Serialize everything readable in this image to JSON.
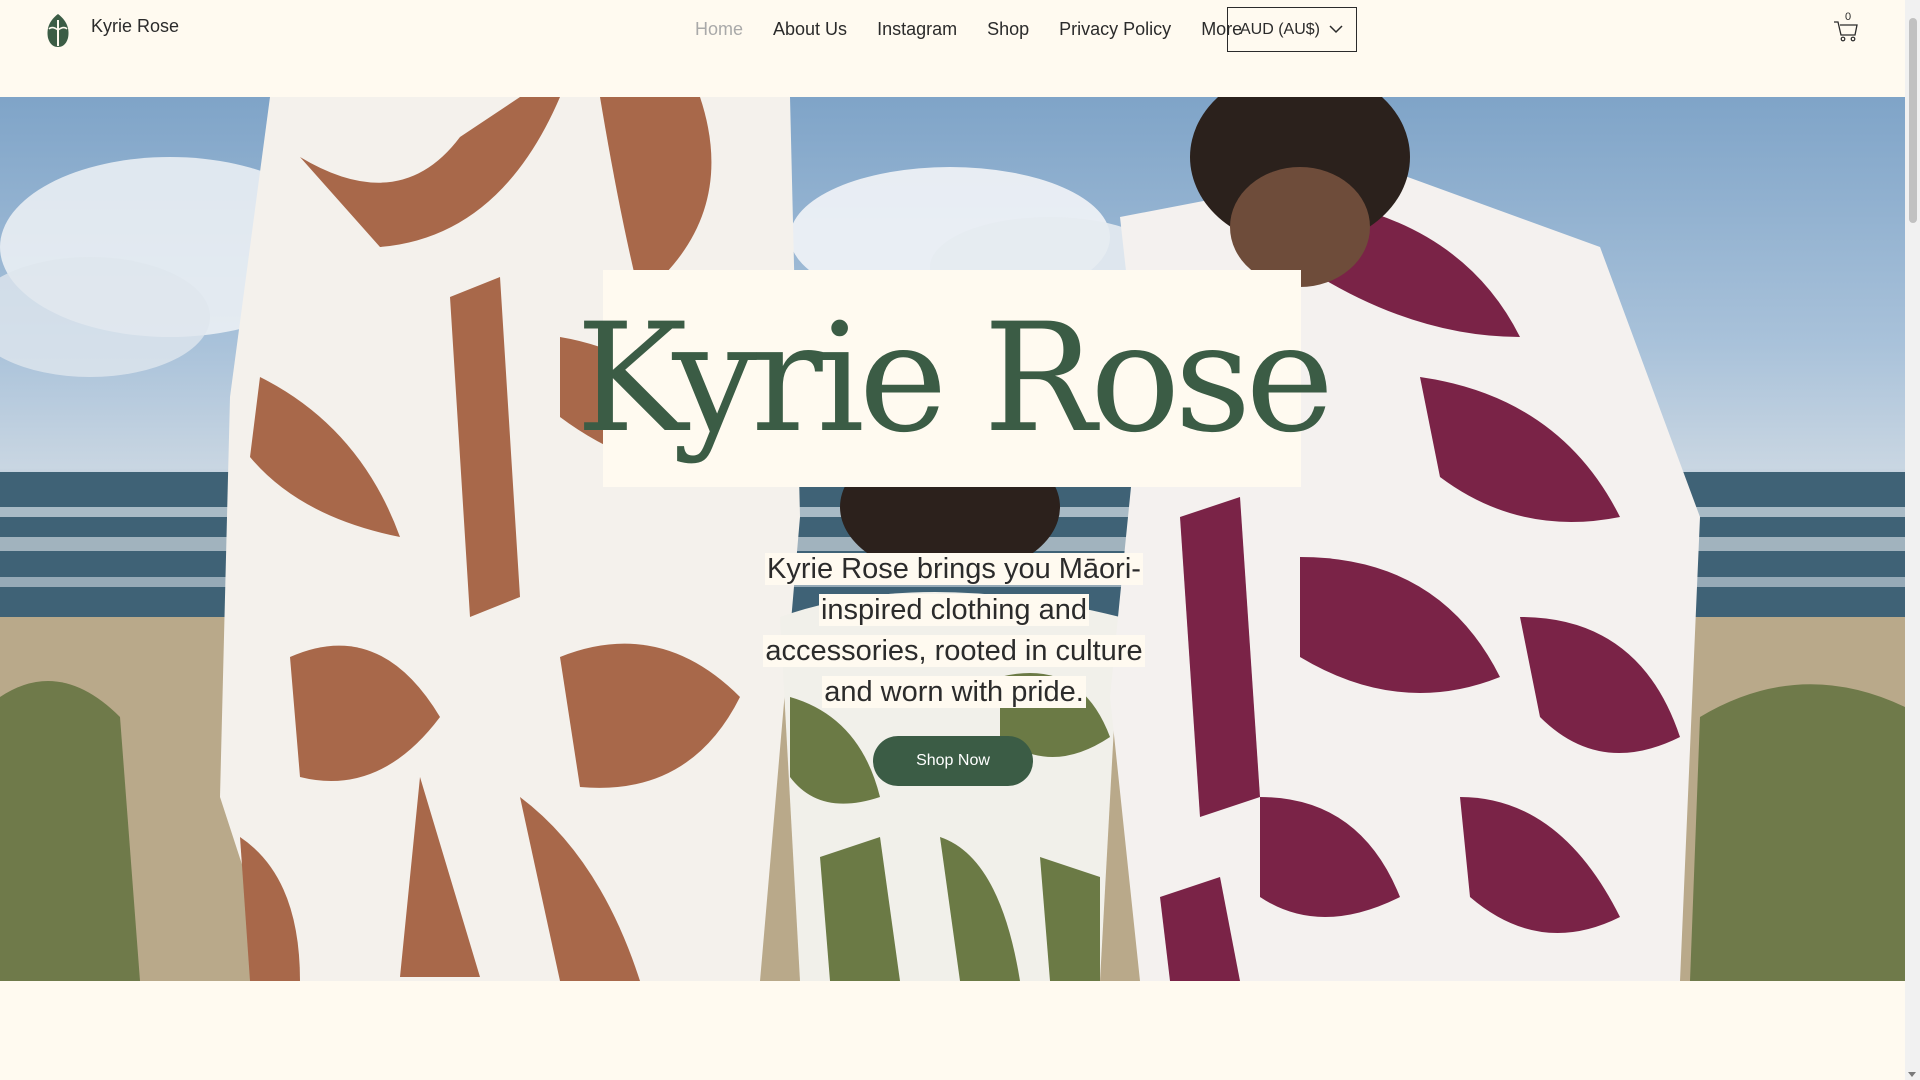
{
  "header": {
    "brand": "Kyrie Rose",
    "logo_icon": "leaf-logo-icon",
    "nav": [
      {
        "label": "Home",
        "active": true
      },
      {
        "label": "About Us"
      },
      {
        "label": "Instagram"
      },
      {
        "label": "Shop"
      },
      {
        "label": "Privacy Policy"
      },
      {
        "label": "More"
      }
    ],
    "currency": "AUD (AU$)",
    "cart_count": "0"
  },
  "hero": {
    "title": "Kyrie Rose",
    "tagline": "Kyrie Rose brings you Māori-inspired clothing and accessories, rooted in culture and worn with pride.",
    "cta": "Shop Now"
  },
  "colors": {
    "background": "#fffaf0",
    "brand_green": "#3b5c45",
    "nav_active": "#a9a9a9",
    "towel_brown": "#a8684a",
    "towel_maroon": "#7a2347",
    "towel_olive": "#6b7a45"
  }
}
